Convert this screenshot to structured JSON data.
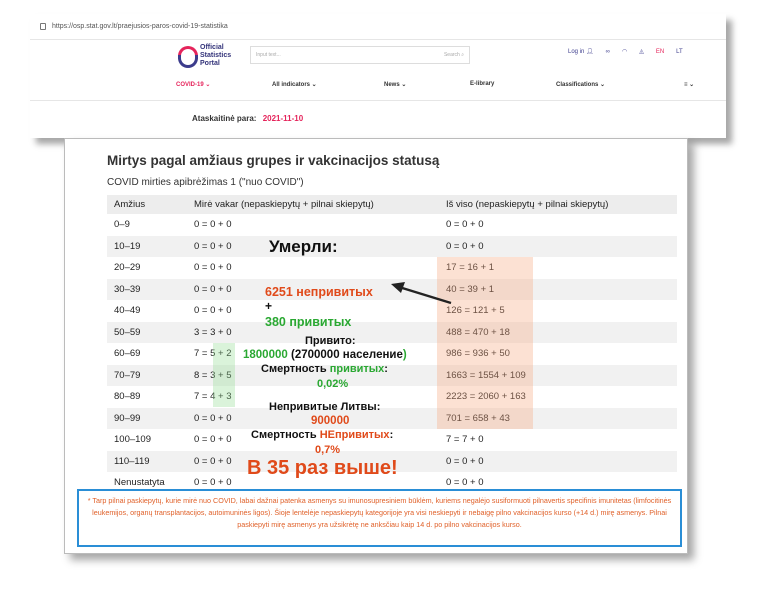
{
  "browser": {
    "url": "https://osp.stat.gov.lt/praejusios-paros-covid-19-statistika"
  },
  "site": {
    "logo_line1": "Official",
    "logo_line2": "Statistics",
    "logo_line3": "Portal",
    "search_placeholder": "Input text...",
    "search_label": "Search",
    "login_label": "Log in",
    "lang_en": "EN",
    "lang_lt": "LT",
    "nav": [
      {
        "label": "COVID-19 ⌄"
      },
      {
        "label": "All indicators ⌄"
      },
      {
        "label": "News ⌄"
      },
      {
        "label": "E-library"
      },
      {
        "label": "Classifications ⌄"
      },
      {
        "label": "≡ ⌄"
      }
    ],
    "report_date_label": "Ataskaitinė para:",
    "report_date_value": "2021-11-10"
  },
  "main": {
    "title": "Mirtys pagal amžiaus grupes ir vakcinacijos statusą",
    "subtitle": "COVID mirties apibrėžimas 1 (\"nuo COVID\")",
    "columns": [
      "Amžius",
      "Mirė vakar (nepaskiepytų + pilnai skiepytų)",
      "Iš viso (nepaskiepytų + pilnai skiepytų)"
    ],
    "rows": [
      {
        "age": "0–9",
        "yesterday": "0 = 0 + 0",
        "total": "0 = 0 + 0"
      },
      {
        "age": "10–19",
        "yesterday": "0 = 0 + 0",
        "total": "0 = 0 + 0"
      },
      {
        "age": "20–29",
        "yesterday": "0 = 0 + 0",
        "total": "17 = 16 + 1"
      },
      {
        "age": "30–39",
        "yesterday": "0 = 0 + 0",
        "total": "40 = 39 + 1"
      },
      {
        "age": "40–49",
        "yesterday": "0 = 0 + 0",
        "total": "126 = 121 + 5"
      },
      {
        "age": "50–59",
        "yesterday": "3 = 3 + 0",
        "total": "488 = 470 + 18"
      },
      {
        "age": "60–69",
        "yesterday": "7 = 5 + 2",
        "total": "986 = 936 + 50"
      },
      {
        "age": "70–79",
        "yesterday": "8 = 3 + 5",
        "total": "1663 = 1554 + 109"
      },
      {
        "age": "80–89",
        "yesterday": "7 = 4 + 3",
        "total": "2223 = 2060 + 163"
      },
      {
        "age": "90–99",
        "yesterday": "0 = 0 + 0",
        "total": "701 = 658 + 43"
      },
      {
        "age": "100–109",
        "yesterday": "0 = 0 + 0",
        "total": "7 = 7 + 0"
      },
      {
        "age": "110–119",
        "yesterday": "0 = 0 + 0",
        "total": "0 = 0 + 0"
      },
      {
        "age": "Nenustatyta",
        "yesterday": "0 = 0 + 0",
        "total": "0 = 0 + 0"
      }
    ]
  },
  "annotation": {
    "died": "Умерли:",
    "unvaccinated_count": "6251 непривитых",
    "plus": "+",
    "vaccinated_count": "380 привитых",
    "vaccinated_label": "Привито:",
    "vaccinated_number": "1800000",
    "population_open": "(",
    "population_text": "2700000 население",
    "population_close": ")",
    "vax_mortality_label": "Смертность",
    "vax_mortality_word": "привитых",
    "vax_mortality_colon": ":",
    "vax_mortality_value": "0,02%",
    "unvax_lithuania_label": "Непривитые Литвы:",
    "unvax_lithuania_value": "900000",
    "unvax_mortality_label": "Смертность",
    "unvax_mortality_word": "НЕпривитых",
    "unvax_mortality_colon": ":",
    "unvax_mortality_value": "0,7%",
    "times_higher": "В 35 раз выше!"
  },
  "footnote": "* Tarp pilnai paskiepytų, kurie mirė nuo COVID, labai dažnai patenka asmenys su imunosupresiniem būklėm, kuriems negalėjo susiformuoti pilnavertis specifinis imunitetas (limfocitinės leukemijos, organų transplantacijos, autoimuninės ligos). Šioje lentelėje nepaskiepytų kategorijoje yra visi neskiepyti ir nebaigę pilno vakcinacijos kurso (+14 d.) mirę asmenys. Pilnai paskiepyti mirę asmenys yra užsikrėtę ne anksčiau kaip 14 d. po pilno vakcinacijos kurso.",
  "colors": {
    "brand_pink": "#e5245b",
    "brand_navy": "#3c3c8c",
    "annotation_red": "#e04a1a",
    "annotation_green": "#2aa832",
    "footnote_border": "#2a8ed6"
  }
}
